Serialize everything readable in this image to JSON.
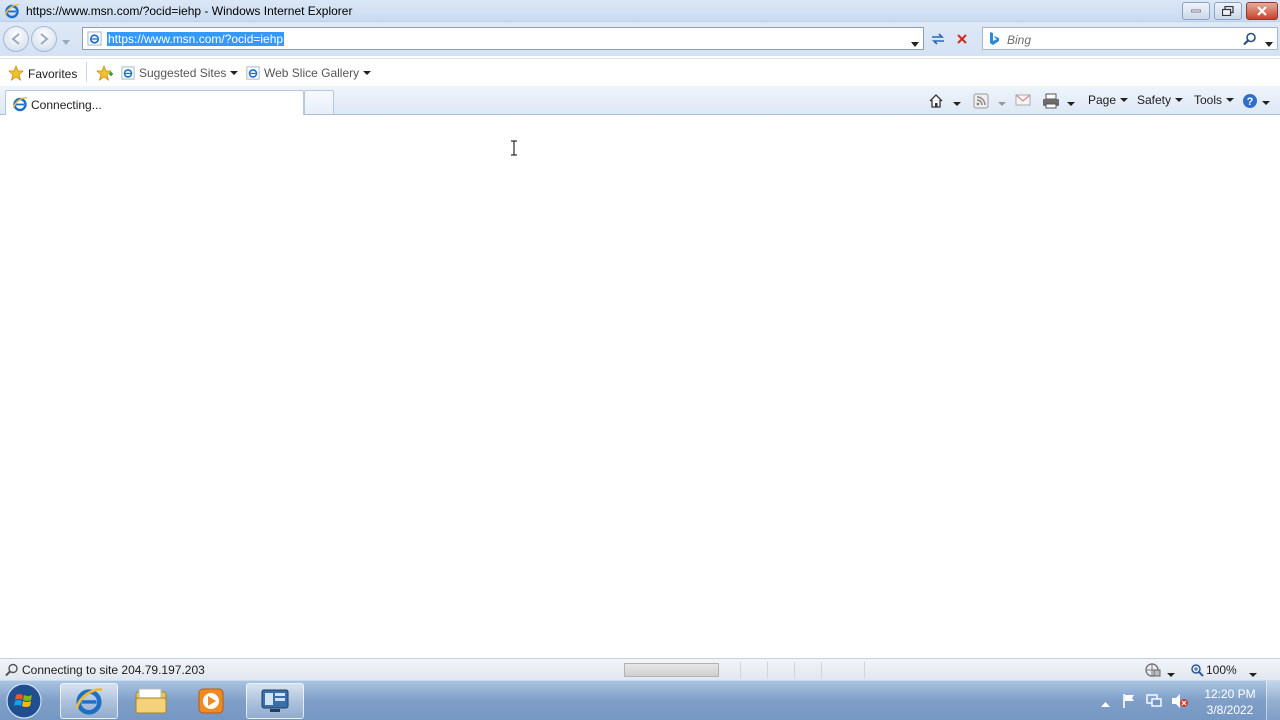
{
  "window": {
    "title": "https://www.msn.com/?ocid=iehp - Windows Internet Explorer"
  },
  "address_bar": {
    "url": "https://www.msn.com/?ocid=iehp"
  },
  "search": {
    "placeholder": "Bing"
  },
  "favorites_bar": {
    "favorites_label": "Favorites",
    "items": [
      {
        "label": "Suggested Sites"
      },
      {
        "label": "Web Slice Gallery"
      }
    ]
  },
  "tab": {
    "label": "Connecting..."
  },
  "command_bar": {
    "page_label": "Page",
    "safety_label": "Safety",
    "tools_label": "Tools"
  },
  "status_bar": {
    "text": "Connecting to site 204.79.197.203",
    "zoom": "100%"
  },
  "taskbar": {
    "time": "12:20 PM",
    "date": "3/8/2022"
  },
  "colors": {
    "selection": "#3399ff",
    "ie_blue": "#1c6fc8",
    "close_red": "#c7442c"
  }
}
